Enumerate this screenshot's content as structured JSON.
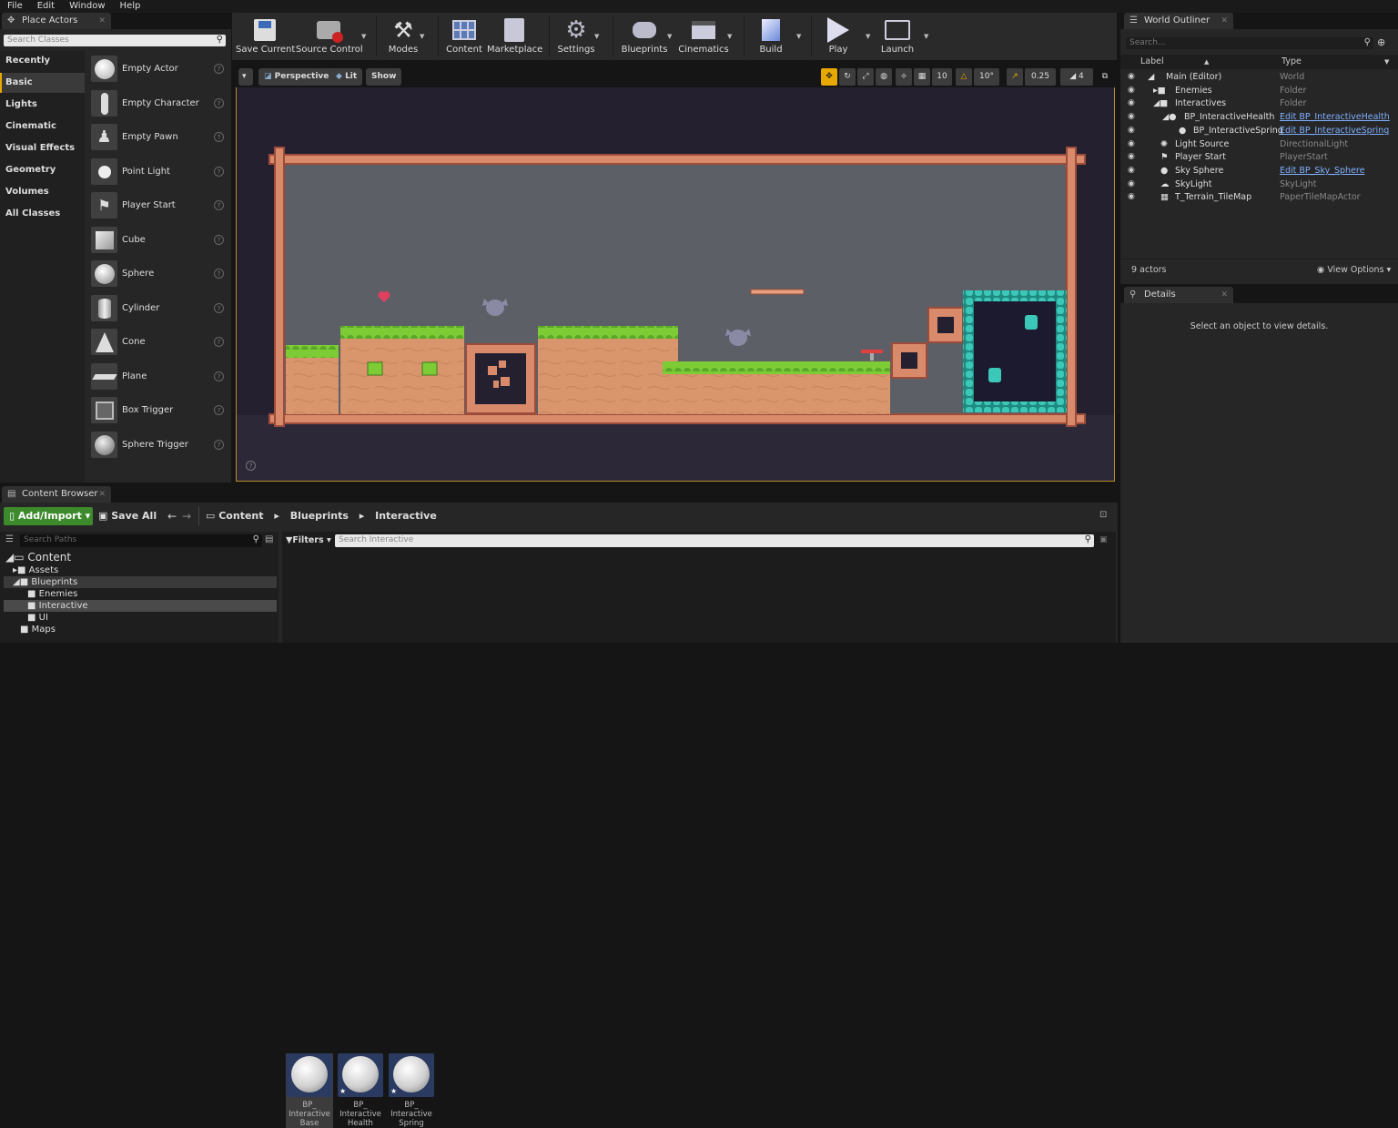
{
  "menu": [
    "File",
    "Edit",
    "Window",
    "Help"
  ],
  "place_actors": {
    "tab": "Place Actors",
    "search_placeholder": "Search Classes",
    "categories": [
      "Recently Placed",
      "Basic",
      "Lights",
      "Cinematic",
      "Visual Effects",
      "Geometry",
      "Volumes",
      "All Classes"
    ],
    "selected_category": "Basic",
    "items": [
      "Empty Actor",
      "Empty Character",
      "Empty Pawn",
      "Point Light",
      "Player Start",
      "Cube",
      "Sphere",
      "Cylinder",
      "Cone",
      "Plane",
      "Box Trigger",
      "Sphere Trigger"
    ]
  },
  "toolbar": {
    "buttons": [
      "Save Current",
      "Source Control",
      "Modes",
      "Content",
      "Marketplace",
      "Settings",
      "Blueprints",
      "Cinematics",
      "Build",
      "Play",
      "Launch"
    ]
  },
  "viewport": {
    "perspective": "Perspective",
    "lit": "Lit",
    "show": "Show",
    "grid_snap": "10",
    "rotation_snap": "10°",
    "scale_snap": "0.25",
    "camera_speed": "4"
  },
  "outliner": {
    "tab": "World Outliner",
    "search_placeholder": "Search...",
    "col_label": "Label",
    "col_type": "Type",
    "rows": [
      {
        "label": "Main (Editor)",
        "type": "World",
        "link": false
      },
      {
        "label": "Enemies",
        "type": "Folder",
        "link": false
      },
      {
        "label": "Interactives",
        "type": "Folder",
        "link": false
      },
      {
        "label": "BP_InteractiveHealth",
        "type": "Edit BP_InteractiveHealth",
        "link": true
      },
      {
        "label": "BP_InteractiveSpring",
        "type": "Edit BP_InteractiveSpring",
        "link": true
      },
      {
        "label": "Light Source",
        "type": "DirectionalLight",
        "link": false
      },
      {
        "label": "Player Start",
        "type": "PlayerStart",
        "link": false
      },
      {
        "label": "Sky Sphere",
        "type": "Edit BP_Sky_Sphere",
        "link": true
      },
      {
        "label": "SkyLight",
        "type": "SkyLight",
        "link": false
      },
      {
        "label": "T_Terrain_TileMap",
        "type": "PaperTileMapActor",
        "link": false
      }
    ],
    "count": "9 actors",
    "view_options": "View Options"
  },
  "details": {
    "tab": "Details",
    "empty": "Select an object to view details."
  },
  "content_browser": {
    "tab": "Content Browser",
    "add_import": "Add/Import",
    "save_all": "Save All",
    "breadcrumb": [
      "Content",
      "Blueprints",
      "Interactive"
    ],
    "search_paths": "Search Paths",
    "filters": "Filters",
    "search_assets": "Search Interactive",
    "tree": [
      {
        "label": "Content",
        "level": 0
      },
      {
        "label": "Assets",
        "level": 1
      },
      {
        "label": "Blueprints",
        "level": 1
      },
      {
        "label": "Enemies",
        "level": 2
      },
      {
        "label": "Interactive",
        "level": 2
      },
      {
        "label": "UI",
        "level": 2
      },
      {
        "label": "Maps",
        "level": 1
      }
    ],
    "assets": [
      {
        "line1": "BP_",
        "line2": "Interactive",
        "line3": "Base"
      },
      {
        "line1": "BP_",
        "line2": "Interactive",
        "line3": "Health"
      },
      {
        "line1": "BP_",
        "line2": "Interactive",
        "line3": "Spring"
      }
    ]
  }
}
